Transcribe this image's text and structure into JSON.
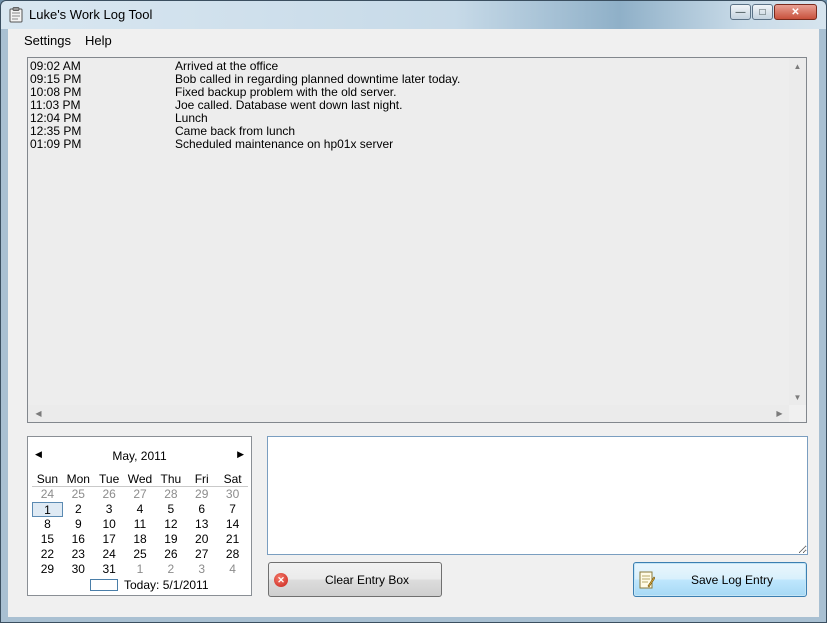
{
  "window": {
    "title": "Luke's Work Log Tool",
    "min_glyph": "—",
    "max_glyph": "□",
    "close_glyph": "✕"
  },
  "menu": {
    "settings": "Settings",
    "help": "Help"
  },
  "log": {
    "entries": [
      {
        "time": "09:02 AM",
        "text": "Arrived at the office"
      },
      {
        "time": "09:15 PM",
        "text": "Bob called in regarding planned downtime later today."
      },
      {
        "time": "10:08 PM",
        "text": "Fixed backup problem with the old server."
      },
      {
        "time": "11:03 PM",
        "text": "Joe called. Database went down last night."
      },
      {
        "time": "12:04 PM",
        "text": "Lunch"
      },
      {
        "time": "12:35 PM",
        "text": "Came back from lunch"
      },
      {
        "time": "01:09 PM",
        "text": "Scheduled maintenance on hp01x server"
      }
    ]
  },
  "calendar": {
    "month_label": "May, 2011",
    "prev_glyph": "◀",
    "next_glyph": "▶",
    "weekdays": [
      "Sun",
      "Mon",
      "Tue",
      "Wed",
      "Thu",
      "Fri",
      "Sat"
    ],
    "weeks": [
      [
        "24",
        "25",
        "26",
        "27",
        "28",
        "29",
        "30"
      ],
      [
        "1",
        "2",
        "3",
        "4",
        "5",
        "6",
        "7"
      ],
      [
        "8",
        "9",
        "10",
        "11",
        "12",
        "13",
        "14"
      ],
      [
        "15",
        "16",
        "17",
        "18",
        "19",
        "20",
        "21"
      ],
      [
        "22",
        "23",
        "24",
        "25",
        "26",
        "27",
        "28"
      ],
      [
        "29",
        "30",
        "31",
        "1",
        "2",
        "3",
        "4"
      ]
    ],
    "selected": "1",
    "today_label": "Today: 5/1/2011"
  },
  "entry": {
    "value": ""
  },
  "buttons": {
    "clear_label": "Clear Entry Box",
    "clear_icon": "red-x-circle-icon",
    "save_label": "Save Log Entry",
    "save_icon": "notepad-pencil-icon"
  }
}
